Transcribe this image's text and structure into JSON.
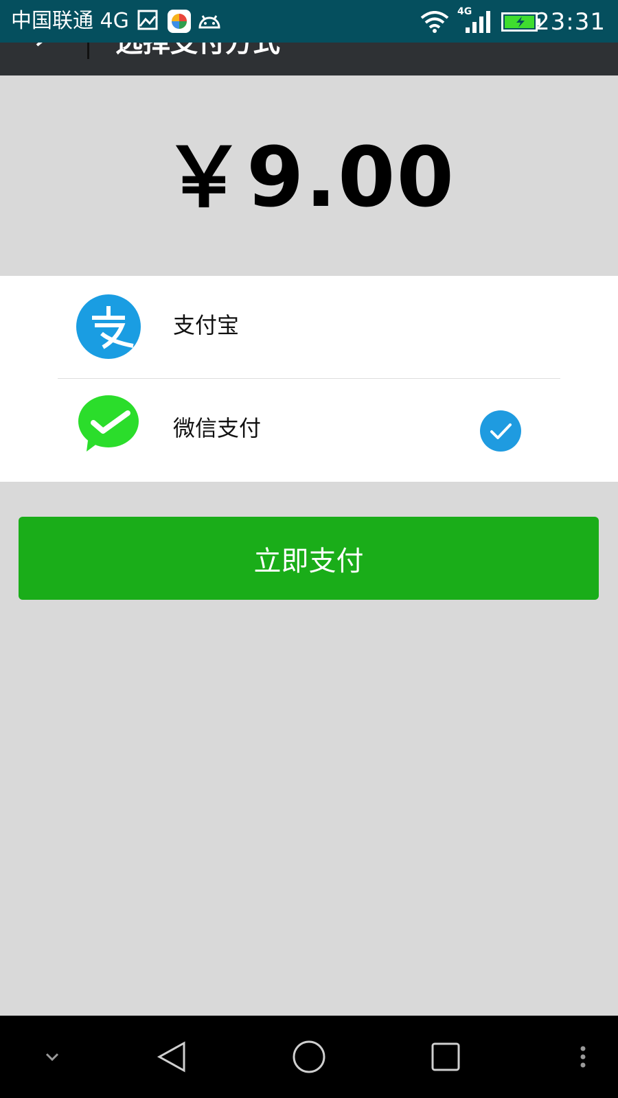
{
  "status_bar": {
    "carrier": "中国联通 4G",
    "network_badge": "4G",
    "time": "23:31",
    "icons": [
      "gallery-icon",
      "app-store-icon",
      "android-icon",
      "wifi-icon",
      "signal-icon",
      "battery-charging-icon"
    ]
  },
  "toolbar": {
    "title": "选择支付方式",
    "back_icon": "back-arrow-icon"
  },
  "amount": "￥9.00",
  "payment_methods": [
    {
      "label": "支付宝",
      "icon": "alipay-icon",
      "selected": false
    },
    {
      "label": "微信支付",
      "icon": "wechat-pay-icon",
      "selected": true
    }
  ],
  "pay_button": "立即支付",
  "nav_bar": {
    "icons": [
      "chevron-down-icon",
      "back-triangle-icon",
      "home-circle-icon",
      "recents-square-icon",
      "more-dots-icon"
    ]
  },
  "colors": {
    "status_bar_bg": "#054f5e",
    "toolbar_bg": "#2e3134",
    "page_bg": "#d9d9d9",
    "pay_button_bg": "#1aad19",
    "alipay_blue": "#1a9de2",
    "wechat_green": "#2bdd2b",
    "check_blue": "#1f9be0"
  }
}
